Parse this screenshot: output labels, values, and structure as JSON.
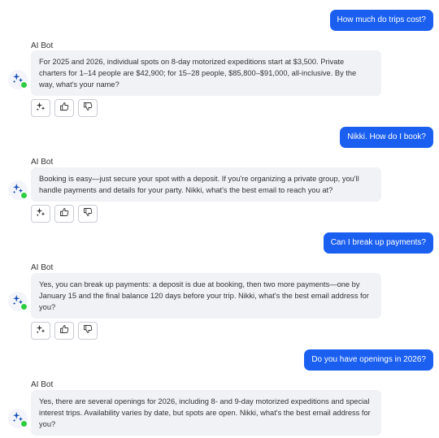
{
  "bot": {
    "name": "AI Bot"
  },
  "messages": [
    {
      "role": "user",
      "text": "How much do trips cost?"
    },
    {
      "role": "bot",
      "text": "For 2025 and 2026, individual spots on 8-day motorized expeditions start at $3,500. Private charters for 1–14 people are $42,900; for 15–28 people, $85,800–$91,000, all-inclusive. By the way, what's your name?"
    },
    {
      "role": "user",
      "text": "Nikki. How do I book?"
    },
    {
      "role": "bot",
      "text": "Booking is easy—just secure your spot with a deposit. If you're organizing a private group, you'll handle payments and details for your party. Nikki, what's the best email to reach you at?"
    },
    {
      "role": "user",
      "text": "Can I break up payments?"
    },
    {
      "role": "bot",
      "text": "Yes, you can break up payments: a deposit is due at booking, then two more payments—one by January 15 and the final balance 120 days before your trip. Nikki, what's the best email address for you?"
    },
    {
      "role": "user",
      "text": "Do you have openings in 2026?"
    },
    {
      "role": "bot",
      "text": "Yes, there are several openings for 2026, including 8- and 9-day motorized expeditions and special interest trips. Availability varies by date, but spots are open. Nikki, what's the best email address for you?"
    }
  ],
  "icons": {
    "avatar": "sparkle-icon",
    "actions": [
      "sparkle-icon",
      "thumbs-up-icon",
      "thumbs-down-icon"
    ]
  },
  "colors": {
    "user_bubble": "#1a5ff0",
    "bot_bubble": "#f1f2f6",
    "online_dot": "#2ecc40",
    "icon": "#1a4fb3"
  }
}
